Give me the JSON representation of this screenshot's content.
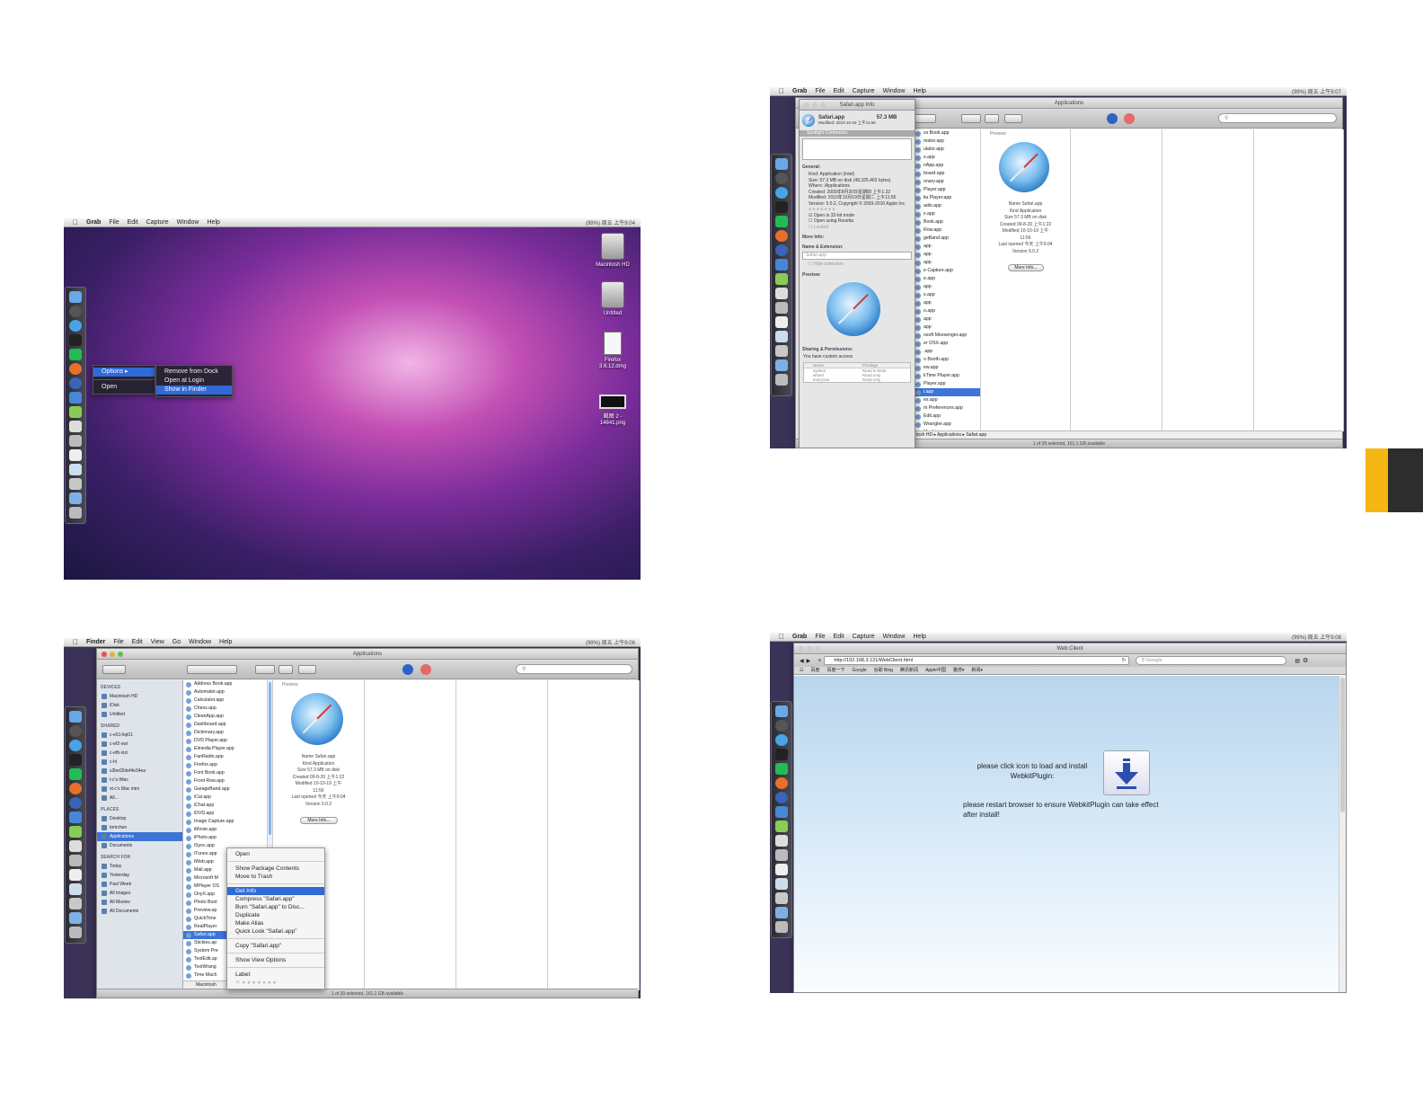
{
  "colors": {
    "accent_tab": "#f5b714",
    "dark_tab": "#2d2d2d",
    "selection": "#2f6ad8"
  },
  "shot1": {
    "menubar": {
      "app": "Grab",
      "items": [
        "File",
        "Edit",
        "Capture",
        "Window",
        "Help"
      ],
      "tray": "(99%)  周五 上午9:04"
    },
    "context_menu": {
      "options": "Options",
      "open": "Open"
    },
    "submenu": [
      "Remove from Dock",
      "Open at Login",
      "Show in Finder"
    ],
    "desktop_icons": [
      "Macintosh HD",
      "Untitled",
      "Firefox 3.6.12.dmg",
      "截图 2 - 14841.png"
    ]
  },
  "shot2": {
    "menubar": {
      "app": "Grab",
      "items": [
        "File",
        "Edit",
        "Capture",
        "Window",
        "Help"
      ],
      "tray": "(99%)  周五 上午9:07"
    },
    "window_title": "Applications",
    "info_title": "Safari.app Info",
    "info_name": "Safari.app",
    "info_size": "57.3 MB",
    "info_modified": "Modified: 2010-10-19 上午11:56",
    "spotlight": "Spotlight Comments:",
    "general_header": "General:",
    "general_lines": [
      "Kind: Application (Intel)",
      "Size: 57.3 MB on disk (48,325,463 bytes)",
      "Where: /Applications",
      "Created: 2009年8月20日星期四 上午1:22",
      "Modified: 2010年10月19日星期二 上午11:56",
      "Version: 5.0.2, Copyright © 2003-2010 Apple Inc."
    ],
    "open32": "Open in 32-bit mode",
    "rosetta": "Open using Rosetta",
    "locked": "Locked",
    "more_info": "More Info:",
    "name_ext": "Name & Extension:",
    "name_value": "Safari.app",
    "hide_ext": "Hide extension",
    "preview_header": "Preview:",
    "sharing": "Sharing & Permissions:",
    "custom_access": "You have custom access",
    "perm_headers": [
      "Name",
      "Privilege"
    ],
    "perm_rows": [
      [
        "system",
        "Read & Write"
      ],
      [
        "wheel",
        "Read only"
      ],
      [
        "everyone",
        "Read only"
      ]
    ],
    "column_items": [
      "ss Book.app",
      "mator.app",
      "ulator.app",
      "s.app",
      "nApp.app",
      "board.app",
      "onary.app",
      "Player.app",
      "lia Player.app",
      "adio.app",
      "x.app",
      "Book.app",
      "Row.app",
      "geBand.app",
      "app",
      "app",
      "app",
      "e Capture.app",
      "e.app",
      "app",
      "s.app",
      "app",
      "o.app",
      "app",
      "app",
      "osoft Messenger.app",
      "er OSX.app",
      ".app",
      "o Booth.app",
      "ew.app",
      "kTime Player.app",
      "Player.app",
      "i.app",
      "es.app",
      "m Preferences.app",
      "Edit.app",
      "Wrangler.app",
      "Machine.app"
    ],
    "selected_index": 32,
    "preview_label": "Preview",
    "preview_info": "Name Safari.app\nKind Application\nSize 57.3 MB on disk\nCreated 09-8-20 上午1:22\nModified 10-10-19 上午\n11:56\nLast opened 今天 上午9:04\nVersion 5.0.2",
    "more_btn": "More Info...",
    "path": "tosh HD ▸ Applications ▸ Safari.app",
    "status": "1 of 39 selected, 161.1 GB available"
  },
  "shot3": {
    "menubar": {
      "app": "Finder",
      "items": [
        "File",
        "Edit",
        "View",
        "Go",
        "Window",
        "Help"
      ],
      "tray": "(99%)  周五 上午9:06"
    },
    "window_title": "Applications",
    "sidebar": {
      "devices_header": "DEVICES",
      "devices": [
        "Macintosh HD",
        "iDisk",
        "Untitled"
      ],
      "shared_header": "SHARED",
      "shared": [
        "c-e51-liqi01",
        "c-ef2-xwi",
        "c-efb-xizi",
        "c-hi",
        "s2be02def4e34ea",
        "t-c's iMac",
        "xt-c's Mac mini",
        "All..."
      ],
      "places_header": "PLACES",
      "places": [
        "Desktop",
        "tomchen",
        "Applications",
        "Documents"
      ],
      "search_header": "SEARCH FOR",
      "search": [
        "Today",
        "Yesterday",
        "Past Week",
        "All Images",
        "All Movies",
        "All Documents"
      ]
    },
    "column_items": [
      "Address Book.app",
      "Automator.app",
      "Calculator.app",
      "Chess.app",
      "CleanApp.app",
      "Dashboard.app",
      "Dictionary.app",
      "DVD Player.app",
      "Elmedia Player.app",
      "FanRadio.app",
      "Firefox.app",
      "Font Book.app",
      "Front Row.app",
      "GarageBand.app",
      "iCal.app",
      "iChat.app",
      "iDVD.app",
      "Image Capture.app",
      "iMovie.app",
      "iPhoto.app",
      "iSync.app",
      "iTunes.app",
      "iWeb.app",
      "Mail.app",
      "Microsoft M",
      "MPlayer OS",
      "OnyX.app",
      "Photo Boot",
      "Preview.ap",
      "QuickTime",
      "RealPlayer",
      "Safari.app",
      "Stickies.ap",
      "System Pre",
      "TextEdit.ap",
      "TextWrang",
      "Time Mach"
    ],
    "selected_index": 31,
    "preview_label": "Preview",
    "preview_info": "Name Safari.app\nKind Application\nSize 57.3 MB on disk\nCreated 09-8-20 上午1:22\nModified 10-10-19 上午\n11:56\nLast opened 今天 上午9:04\nVersion 5.0.2",
    "more_btn": "More Info...",
    "status": "1 of 39 selected, 161.1 GB available",
    "path_left": "Macintosh",
    "context_menu": [
      "Open",
      "Show Package Contents",
      "Move to Trash",
      "Get Info",
      "Compress \"Safari.app\"",
      "Burn \"Safari.app\" to Disc...",
      "Duplicate",
      "Make Alias",
      "Quick Look \"Safari.app\"",
      "Copy \"Safari.app\"",
      "Show View Options",
      "Label:"
    ],
    "context_selected": 3
  },
  "shot4": {
    "menubar": {
      "app": "Grab",
      "items": [
        "File",
        "Edit",
        "Capture",
        "Window",
        "Help"
      ],
      "tray": "(99%)  周五 上午9:08"
    },
    "window_title": "Web Client",
    "url": "http://192.168.3.131/WebClient.html",
    "search_placeholder": "Google",
    "bookmarks": [
      "百度",
      "百度一下",
      "Google",
      "谷歌 Bing",
      "腾讯新闻",
      "Apple中国",
      "雅虎▾",
      "新闻▾"
    ],
    "msg1": "please click icon to load and install WebkitPlugin:",
    "msg2": "please restart browser to ensure WebkitPlugin can take effect after install!"
  }
}
